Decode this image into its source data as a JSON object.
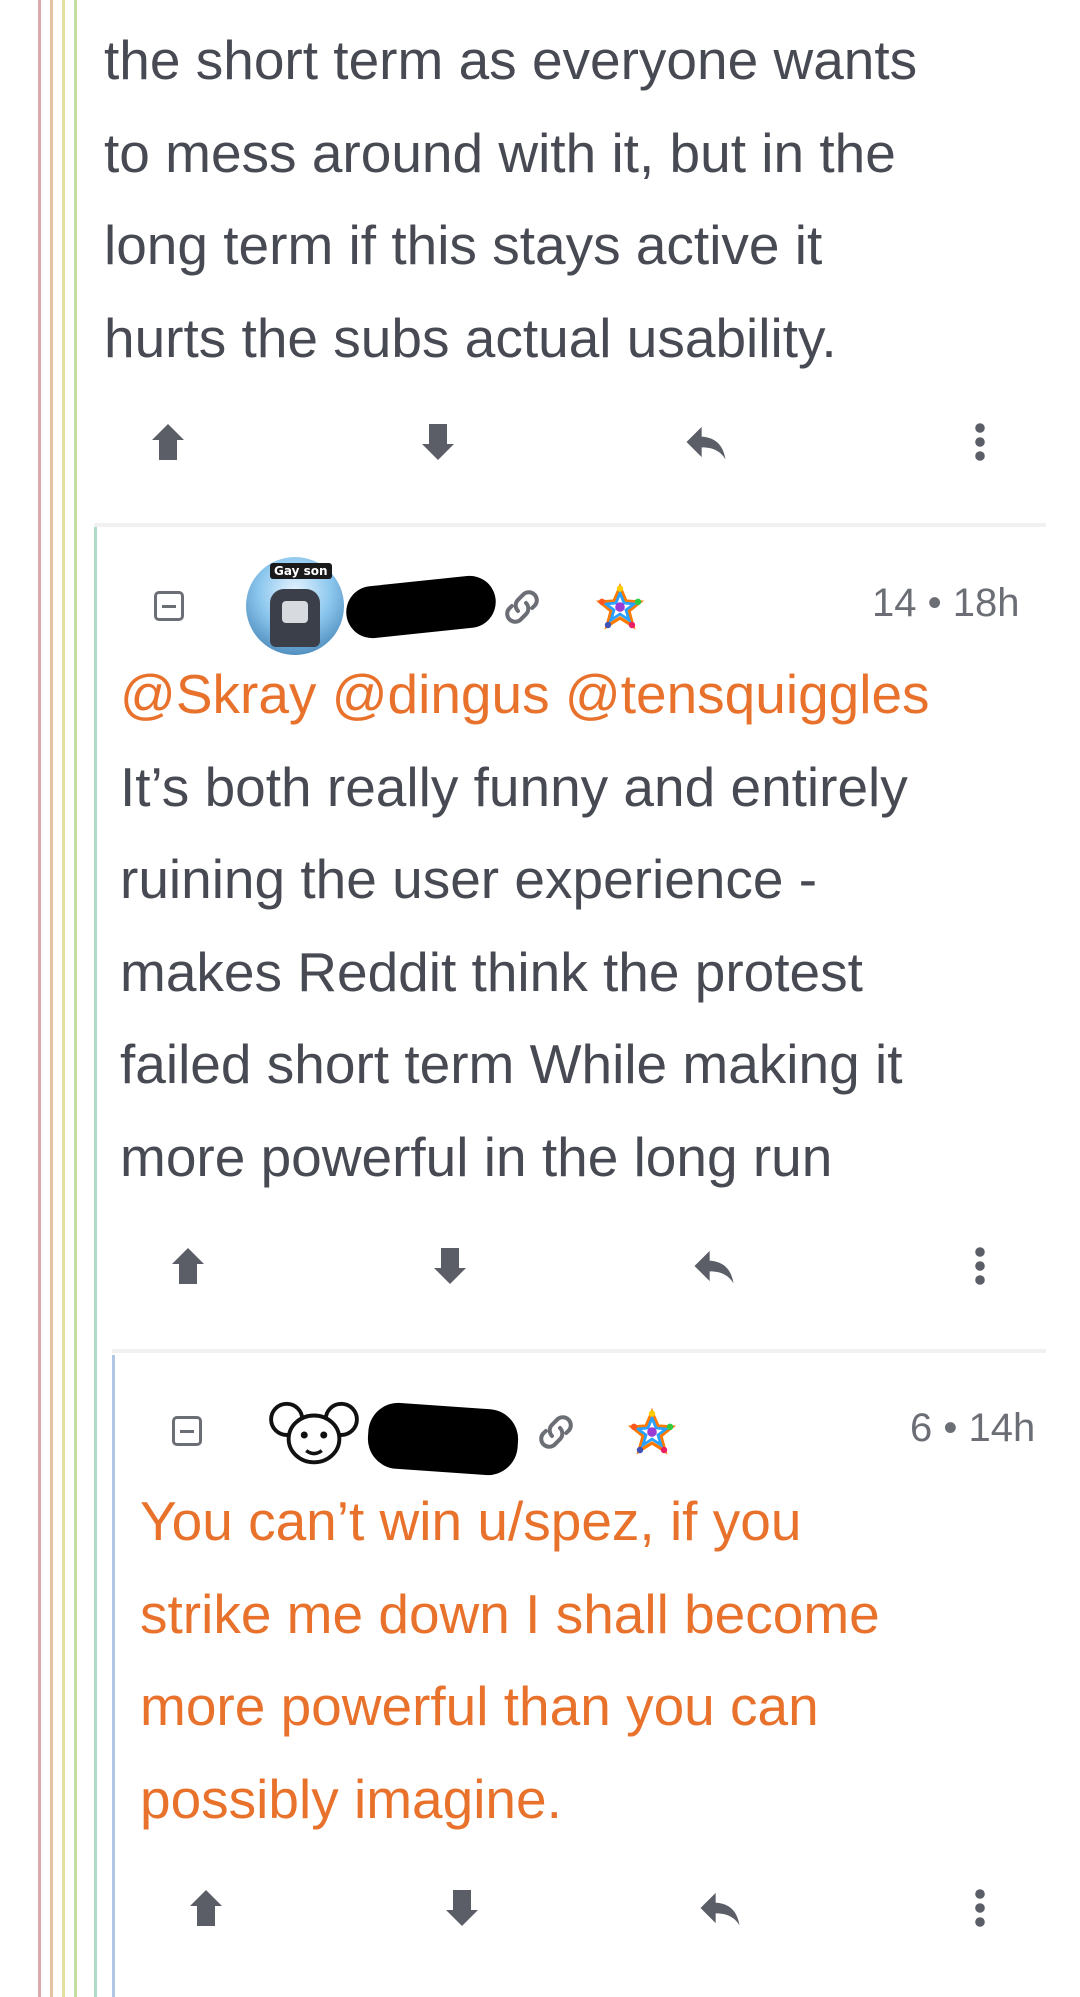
{
  "comments": [
    {
      "body_lines": [
        "the short term as everyone wants",
        "to mess around with it, but in the",
        "long term if this stays active it",
        "hurts the subs actual usability."
      ]
    },
    {
      "avatar_label": "Gay son",
      "score": "14",
      "age": "18h",
      "mentions": "@Skray @dingus @tensquiggles",
      "body_lines": [
        "It’s both really funny and entirely",
        "ruining the user experience -",
        "makes Reddit think the protest",
        "failed short term While making it",
        "more powerful in the long run"
      ]
    },
    {
      "score": "6",
      "age": "14h",
      "body_lines": [
        "You can’t win u/spez, if you",
        "strike me down I shall become",
        "more powerful than you can",
        "possibly imagine."
      ]
    }
  ],
  "icons": {
    "upvote": "arrow-up-icon",
    "downvote": "arrow-down-icon",
    "reply": "reply-icon",
    "more": "more-vertical-icon",
    "collapse": "collapse-icon",
    "link": "link-icon",
    "instance": "rainbow-star-icon"
  },
  "colors": {
    "text": "#474a52",
    "mention": "#e8722c",
    "meta": "#6b6e75",
    "thread_lines": [
      "#d9aaaa",
      "#e6c3a0",
      "#e5dfa0",
      "#c3dea2",
      "#aedcc7",
      "#b0c6e2"
    ]
  }
}
